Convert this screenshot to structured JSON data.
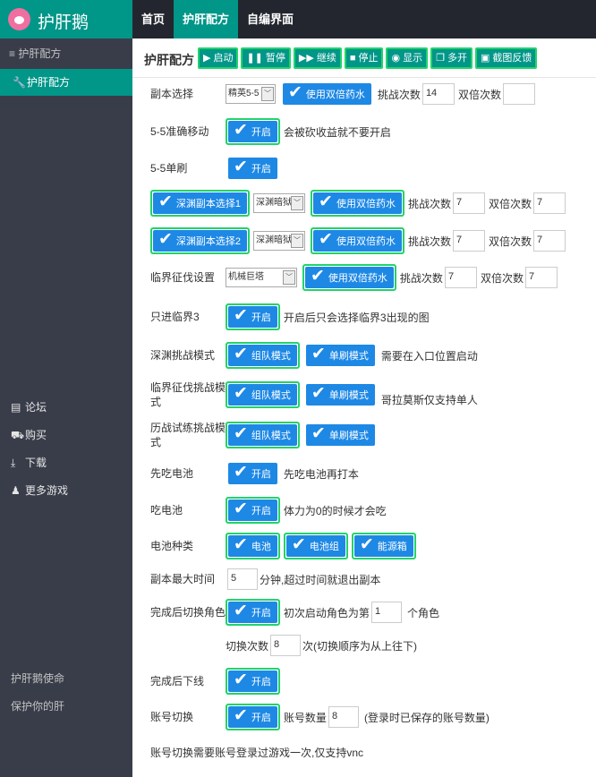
{
  "app": {
    "title": "护肝鹅"
  },
  "topnav": {
    "items": [
      "首页",
      "护肝配方",
      "自编界面"
    ]
  },
  "sidebar": {
    "header": "≡ 护肝配方",
    "active": "护肝配方",
    "links": [
      {
        "icon": "comment-icon",
        "label": "论坛"
      },
      {
        "icon": "cart-icon",
        "label": "购买"
      },
      {
        "icon": "download-icon",
        "label": "下载"
      },
      {
        "icon": "game-icon",
        "label": "更多游戏"
      }
    ],
    "bottom": [
      "护肝鹅使命",
      "保护你的肝"
    ]
  },
  "toolbar": {
    "title": "护肝配方",
    "buttons": [
      {
        "icon": "play-icon",
        "label": "启动"
      },
      {
        "icon": "pause-icon",
        "label": "暂停"
      },
      {
        "icon": "forward-icon",
        "label": "继续"
      },
      {
        "icon": "stop-icon",
        "label": "停止"
      },
      {
        "icon": "eye-icon",
        "label": "显示"
      },
      {
        "icon": "copy-icon",
        "label": "多开"
      },
      {
        "icon": "image-icon",
        "label": "截图反馈"
      }
    ]
  },
  "form": {
    "dungeon": {
      "label": "副本选择",
      "select": "精英5-5",
      "double": "使用双倍药水",
      "challenge_label": "挑战次数",
      "challenge": "14",
      "double_label": "双倍次数",
      "double_count": ""
    },
    "precise": {
      "label": "5-5准确移动",
      "toggle": "开启",
      "hint": "会被砍收益就不要开启"
    },
    "single": {
      "label": "5-5单刷",
      "toggle": "开启"
    },
    "abyss1": {
      "toggle": "深渊副本选择1",
      "select": "深渊暗狱",
      "double": "使用双倍药水",
      "challenge_label": "挑战次数",
      "challenge": "7",
      "double_label": "双倍次数",
      "double_count": "7"
    },
    "abyss2": {
      "toggle": "深渊副本选择2",
      "select": "深渊暗狱",
      "double": "使用双倍药水",
      "challenge_label": "挑战次数",
      "challenge": "7",
      "double_label": "双倍次数",
      "double_count": "7"
    },
    "frontier": {
      "label": "临界征伐设置",
      "select": "机械巨塔",
      "double": "使用双倍药水",
      "challenge_label": "挑战次数",
      "challenge": "7",
      "double_label": "双倍次数",
      "double_count": "7"
    },
    "only3": {
      "label": "只进临界3",
      "toggle": "开启",
      "hint": "开启后只会选择临界3出现的图"
    },
    "abyss_mode": {
      "label": "深渊挑战模式",
      "team": "组队模式",
      "solo": "单刷模式",
      "hint": "需要在入口位置启动"
    },
    "frontier_mode": {
      "label": "临界征伐挑战模式",
      "team": "组队模式",
      "solo": "单刷模式",
      "hint": "哥拉莫斯仅支持单人"
    },
    "trial_mode": {
      "label": "历战试练挑战模式",
      "team": "组队模式",
      "solo": "单刷模式"
    },
    "eat_first": {
      "label": "先吃电池",
      "toggle": "开启",
      "hint": "先吃电池再打本"
    },
    "eat": {
      "label": "吃电池",
      "toggle": "开启",
      "hint": "体力为0的时候才会吃"
    },
    "battery_type": {
      "label": "电池种类",
      "options": [
        "电池",
        "电池组",
        "能源箱"
      ]
    },
    "max_time": {
      "label": "副本最大时间",
      "value": "5",
      "hint": "分钟,超过时间就退出副本"
    },
    "switch_role": {
      "label": "完成后切换角色",
      "toggle": "开启",
      "first_label": "初次启动角色为第",
      "first": "1",
      "unit": "个角色",
      "count_label": "切换次数",
      "count": "8",
      "count_hint": "次(切换顺序为从上往下)"
    },
    "offline": {
      "label": "完成后下线",
      "toggle": "开启"
    },
    "account": {
      "label": "账号切换",
      "toggle": "开启",
      "num_label": "账号数量",
      "num": "8",
      "hint": "(登录时已保存的账号数量)"
    },
    "footer_note": "账号切换需要账号登录过游戏一次,仅支持vnc"
  }
}
